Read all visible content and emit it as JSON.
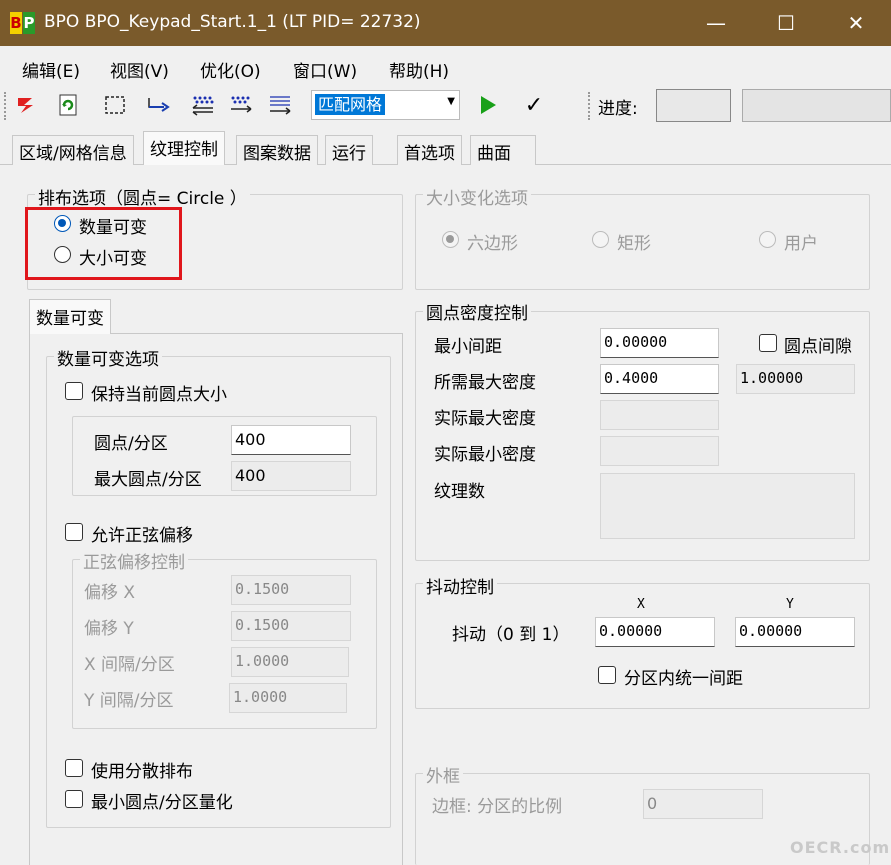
{
  "window": {
    "title": "BPO  BPO_Keypad_Start.1_1 (LT PID= 22732)",
    "logo_left": "B",
    "logo_right": "P",
    "minimize": "—",
    "maximize": "☐",
    "close": "✕"
  },
  "menu": [
    "编辑(E)",
    "视图(V)",
    "优化(O)",
    "窗口(W)",
    "帮助(H)"
  ],
  "toolbar": {
    "combo_value": "匹配网格",
    "progress_label": "进度:",
    "play_icon": "▶",
    "check_icon": "✓"
  },
  "tabs": [
    "区域/网格信息",
    "纹理控制",
    "图案数据",
    "运行",
    "首选项",
    "曲面"
  ],
  "distribution": {
    "title": "排布选项（圆点= Circle ）",
    "options": [
      "数量可变",
      "大小可变"
    ],
    "selected": "数量可变"
  },
  "size_change": {
    "title": "大小变化选项",
    "options": [
      "六边形",
      "矩形",
      "用户"
    ],
    "selected": "六边形"
  },
  "count_panel": {
    "tab": "数量可变",
    "group_title": "数量可变选项",
    "keep_size": "保持当前圆点大小",
    "dots_per_zone_label": "圆点/分区",
    "dots_per_zone_value": "400",
    "max_dots_label": "最大圆点/分区",
    "max_dots_value": "400",
    "allow_sine": "允许正弦偏移",
    "sine_group_title": "正弦偏移控制",
    "offset_x_label": "偏移 X",
    "offset_x_value": "0.1500",
    "offset_y_label": "偏移 Y",
    "offset_y_value": "0.1500",
    "interval_x_label": "X 间隔/分区",
    "interval_x_value": "1.0000",
    "interval_y_label": "Y 间隔/分区",
    "interval_y_value": "1.0000",
    "scatter": "使用分散排布",
    "min_quant": "最小圆点/分区量化"
  },
  "density": {
    "title": "圆点密度控制",
    "min_spacing_label": "最小间距",
    "min_spacing_value": "0.00000",
    "dot_gap_label": "圆点间隙",
    "max_needed_label": "所需最大密度",
    "max_needed_value": "0.4000",
    "max_needed_side": "1.00000",
    "actual_max_label": "实际最大密度",
    "actual_min_label": "实际最小密度",
    "texture_count_label": "纹理数"
  },
  "jitter": {
    "title": "抖动控制",
    "x_header": "X",
    "y_header": "Y",
    "label": "抖动（0 到 1）",
    "x_value": "0.00000",
    "y_value": "0.00000",
    "uniform": "分区内统一间距"
  },
  "frame": {
    "title": "外框",
    "label": "边框: 分区的比例",
    "value": "0"
  },
  "watermark": "OECR.com"
}
